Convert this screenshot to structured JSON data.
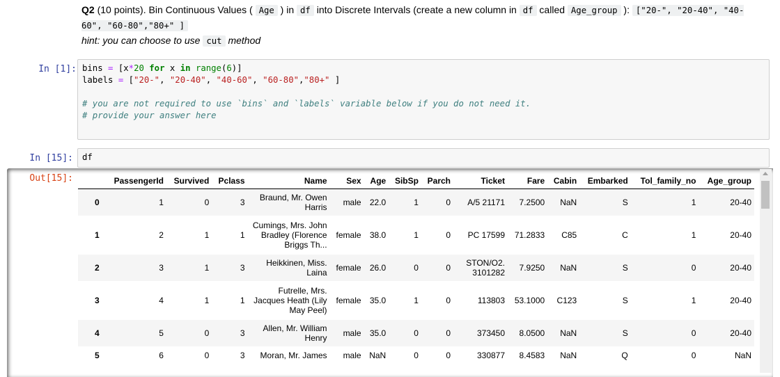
{
  "markdown": {
    "q_label": "Q2",
    "q_text_1": " (10 points). Bin Continuous Values ( ",
    "code_age": "Age",
    "q_text_2": " ) in ",
    "code_df": "df",
    "q_text_3": " into Discrete Intervals (create a new column in ",
    "code_df2": "df",
    "q_text_4": " called ",
    "code_agegroup": "Age_group",
    "q_text_5": " ): ",
    "code_labels": "[\"20-\", \"20-40\", \"40-60\", \"60-80\",\"80+\" ]",
    "hint_1": "hint: you can choose to use ",
    "code_cut": "cut",
    "hint_2": " method"
  },
  "cell1": {
    "prompt": "In [1]:",
    "lines": {
      "l1_a": "bins ",
      "l1_op": "=",
      "l1_b": " [x",
      "l1_op2": "*",
      "l1_num": "20",
      "l1_sp": " ",
      "l1_for": "for",
      "l1_c": " x ",
      "l1_in": "in",
      "l1_sp2": " ",
      "l1_range": "range",
      "l1_d": "(",
      "l1_num2": "6",
      "l1_e": ")]",
      "l2_a": "labels ",
      "l2_op": "=",
      "l2_b": " [",
      "l2_s1": "\"20-\"",
      "l2_c1": ", ",
      "l2_s2": "\"20-40\"",
      "l2_c2": ", ",
      "l2_s3": "\"40-60\"",
      "l2_c3": ", ",
      "l2_s4": "\"60-80\"",
      "l2_c4": ",",
      "l2_s5": "\"80+\"",
      "l2_end": " ]",
      "l4": "# you are not required to use `bins` and `labels` variable below if you do not need it.",
      "l5": "# provide your answer here"
    }
  },
  "cell2": {
    "prompt": "In [15]:",
    "code": "df",
    "out_prompt": "Out[15]:"
  },
  "table": {
    "columns": [
      "",
      "PassengerId",
      "Survived",
      "Pclass",
      "Name",
      "Sex",
      "Age",
      "SibSp",
      "Parch",
      "Ticket",
      "Fare",
      "Cabin",
      "Embarked",
      "Tol_family_no",
      "Age_group"
    ],
    "rows": [
      [
        "0",
        "1",
        "0",
        "3",
        "Braund, Mr. Owen Harris",
        "male",
        "22.0",
        "1",
        "0",
        "A/5 21171",
        "7.2500",
        "NaN",
        "S",
        "1",
        "20-40"
      ],
      [
        "1",
        "2",
        "1",
        "1",
        "Cumings, Mrs. John Bradley (Florence Briggs Th...",
        "female",
        "38.0",
        "1",
        "0",
        "PC 17599",
        "71.2833",
        "C85",
        "C",
        "1",
        "20-40"
      ],
      [
        "2",
        "3",
        "1",
        "3",
        "Heikkinen, Miss. Laina",
        "female",
        "26.0",
        "0",
        "0",
        "STON/O2. 3101282",
        "7.9250",
        "NaN",
        "S",
        "0",
        "20-40"
      ],
      [
        "3",
        "4",
        "1",
        "1",
        "Futrelle, Mrs. Jacques Heath (Lily May Peel)",
        "female",
        "35.0",
        "1",
        "0",
        "113803",
        "53.1000",
        "C123",
        "S",
        "1",
        "20-40"
      ],
      [
        "4",
        "5",
        "0",
        "3",
        "Allen, Mr. William Henry",
        "male",
        "35.0",
        "0",
        "0",
        "373450",
        "8.0500",
        "NaN",
        "S",
        "0",
        "20-40"
      ],
      [
        "5",
        "6",
        "0",
        "3",
        "Moran, Mr. James",
        "male",
        "NaN",
        "0",
        "0",
        "330877",
        "8.4583",
        "NaN",
        "Q",
        "0",
        "NaN"
      ]
    ]
  },
  "scrollbar": {
    "up_icon": "scroll-up-arrow"
  }
}
